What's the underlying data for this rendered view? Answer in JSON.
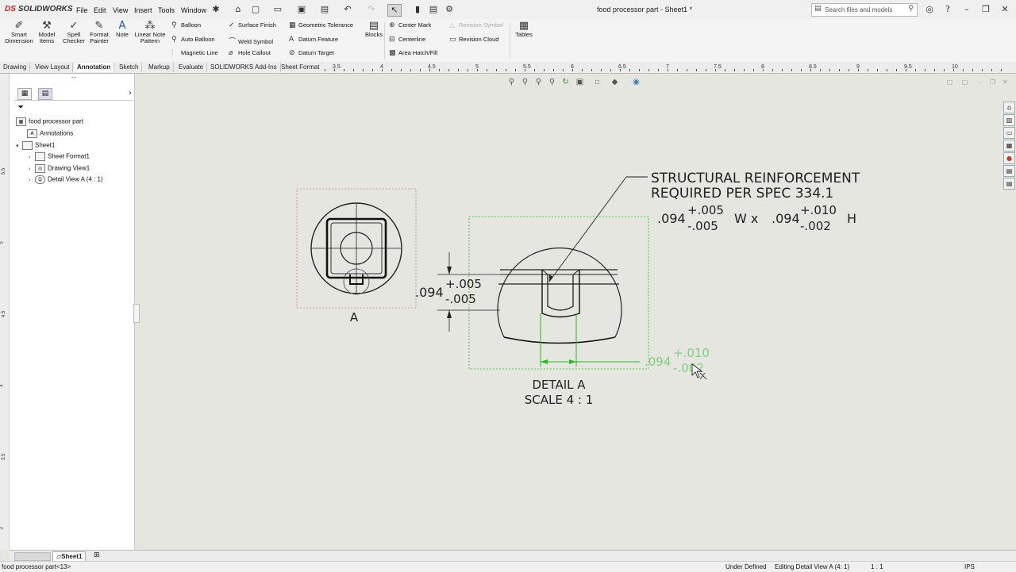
{
  "app": {
    "logo_prefix": "DS",
    "logo_name": "SOLIDWORKS",
    "document_title": "food processor part - Sheet1 *"
  },
  "menu": [
    "File",
    "Edit",
    "View",
    "Insert",
    "Tools",
    "Window"
  ],
  "search": {
    "placeholder": "Search files and models"
  },
  "ribbon": {
    "big_buttons": [
      {
        "l1": "Smart",
        "l2": "Dimension",
        "icon": "smart-dimension-icon"
      },
      {
        "l1": "Model",
        "l2": "Items",
        "icon": "model-items-icon"
      },
      {
        "l1": "Spell",
        "l2": "Checker",
        "icon": "spell-checker-icon"
      },
      {
        "l1": "Format",
        "l2": "Painter",
        "icon": "format-painter-icon"
      },
      {
        "l1": "Note",
        "l2": "",
        "icon": "note-icon"
      },
      {
        "l1": "Linear Note",
        "l2": "Pattern",
        "icon": "linear-note-pattern-icon"
      }
    ],
    "col1": [
      "Balloon",
      "Auto Balloon",
      "Magnetic Line"
    ],
    "col2": [
      "Surface Finish",
      "Weld Symbol",
      "Hole Callout"
    ],
    "col3": [
      "Geometric Tolerance",
      "Datum Feature",
      "Datum Target"
    ],
    "blocks": "Blocks",
    "col4": [
      "Center Mark",
      "Centerline",
      "Area Hatch/Fill"
    ],
    "col5": [
      "Revision Symbol",
      "Revision Cloud"
    ],
    "tables": "Tables"
  },
  "tabs": [
    "Drawing",
    "View Layout",
    "Annotation",
    "Sketch",
    "Markup",
    "Evaluate",
    "SOLIDWORKS Add-Ins",
    "Sheet Format"
  ],
  "active_tab": "Annotation",
  "ruler_top": [
    "3.5",
    "4",
    "4.5",
    "5",
    "5.5",
    "6",
    "6.5",
    "7",
    "7.5",
    "8",
    "8.5",
    "9",
    "9.5",
    "10"
  ],
  "ruler_left": [
    "5.5",
    "5",
    "4.5",
    "4",
    "3.5",
    "3"
  ],
  "tree": {
    "root": "food processor part",
    "annotations": "Annotations",
    "sheet": "Sheet1",
    "sheet_format": "Sheet Format1",
    "drawing_view": "Drawing View1",
    "detail_view": "Detail View A (4 : 1)"
  },
  "drawing": {
    "view_label": "A",
    "note_line1": "STRUCTURAL REINFORCEMENT",
    "note_line2": "REQUIRED PER SPEC 334.1",
    "note_w_base": ".094",
    "note_w_plus": "+.005",
    "note_w_minus": "-.005",
    "note_w_suffix": "W x",
    "note_h_base": ".094",
    "note_h_plus": "+.010",
    "note_h_minus": "-.002",
    "note_h_suffix": "H",
    "dim_v_base": ".094",
    "dim_v_plus": "+.005",
    "dim_v_minus": "-.005",
    "dim_h_base": ".094",
    "dim_h_plus": "+.010",
    "dim_h_minus": "-.002",
    "detail_title": "DETAIL A",
    "detail_scale": "SCALE 4 : 1"
  },
  "sheet_tab": "Sheet1",
  "status": {
    "left": "food processor part<13>",
    "state": "Under Defined",
    "editing": "Editing Detail View A (4: 1)",
    "scale": "1 : 1",
    "units": "IPS"
  },
  "colors": {
    "accent_red": "#d02020",
    "selection_green": "#22bb22",
    "dimension_green": "#66cc66",
    "canvas": "#e6e6e0"
  }
}
